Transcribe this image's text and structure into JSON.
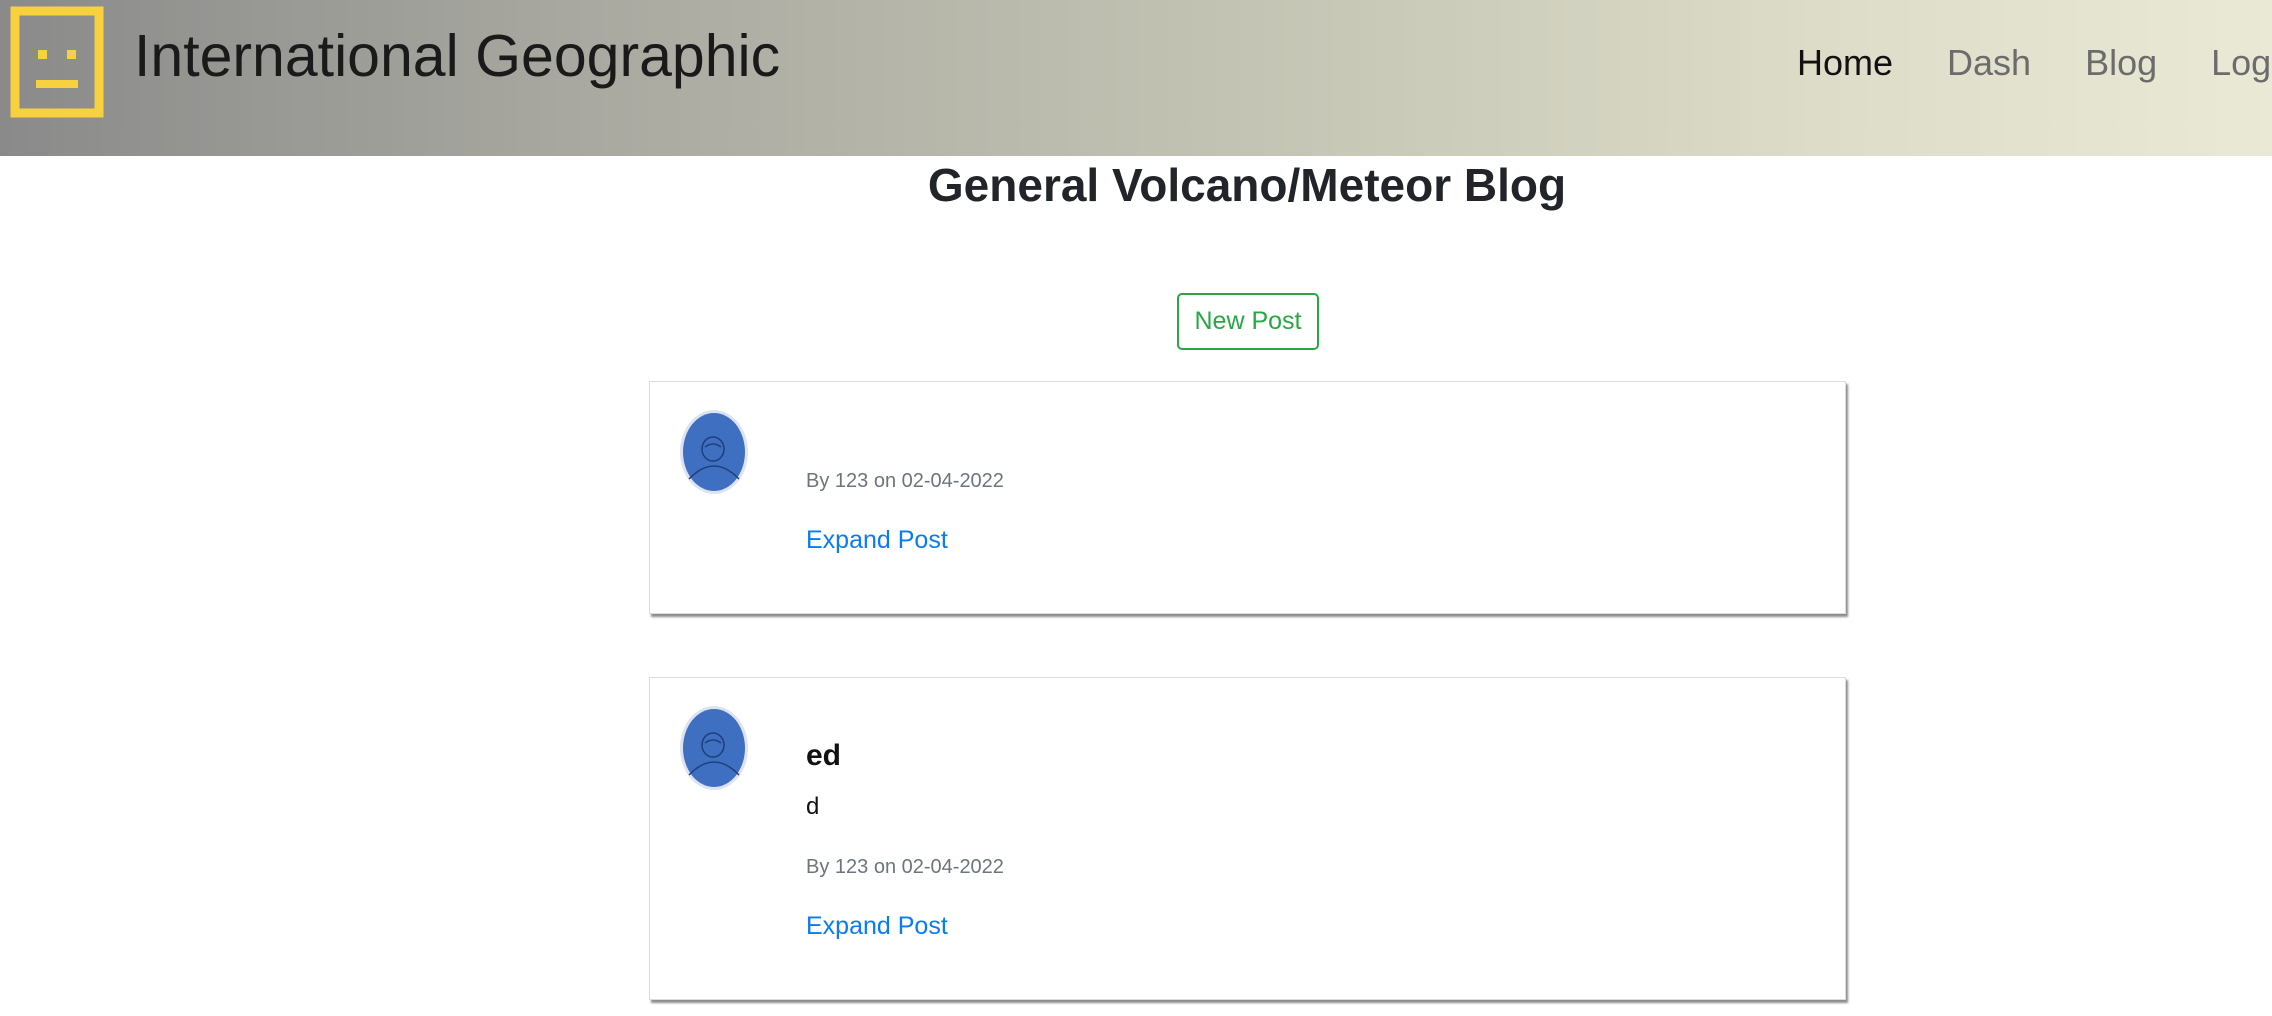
{
  "header": {
    "brand": "International Geographic",
    "nav": [
      {
        "label": "Home",
        "active": true
      },
      {
        "label": "Dash"
      },
      {
        "label": "Blog"
      },
      {
        "label": "Login"
      }
    ],
    "logo_color": "#f7d23e"
  },
  "main": {
    "title": "General Volcano/Meteor Blog",
    "new_post_label": "New Post",
    "posts": [
      {
        "title": "",
        "body": "",
        "meta": "By 123 on 02-04-2022",
        "expand_label": "Expand Post"
      },
      {
        "title": "ed",
        "body": "d",
        "meta": "By 123 on 02-04-2022",
        "expand_label": "Expand Post"
      }
    ]
  },
  "colors": {
    "accent_green": "#28a745",
    "link_blue": "#0a7bf2",
    "avatar_blue": "#3f6fc1"
  }
}
